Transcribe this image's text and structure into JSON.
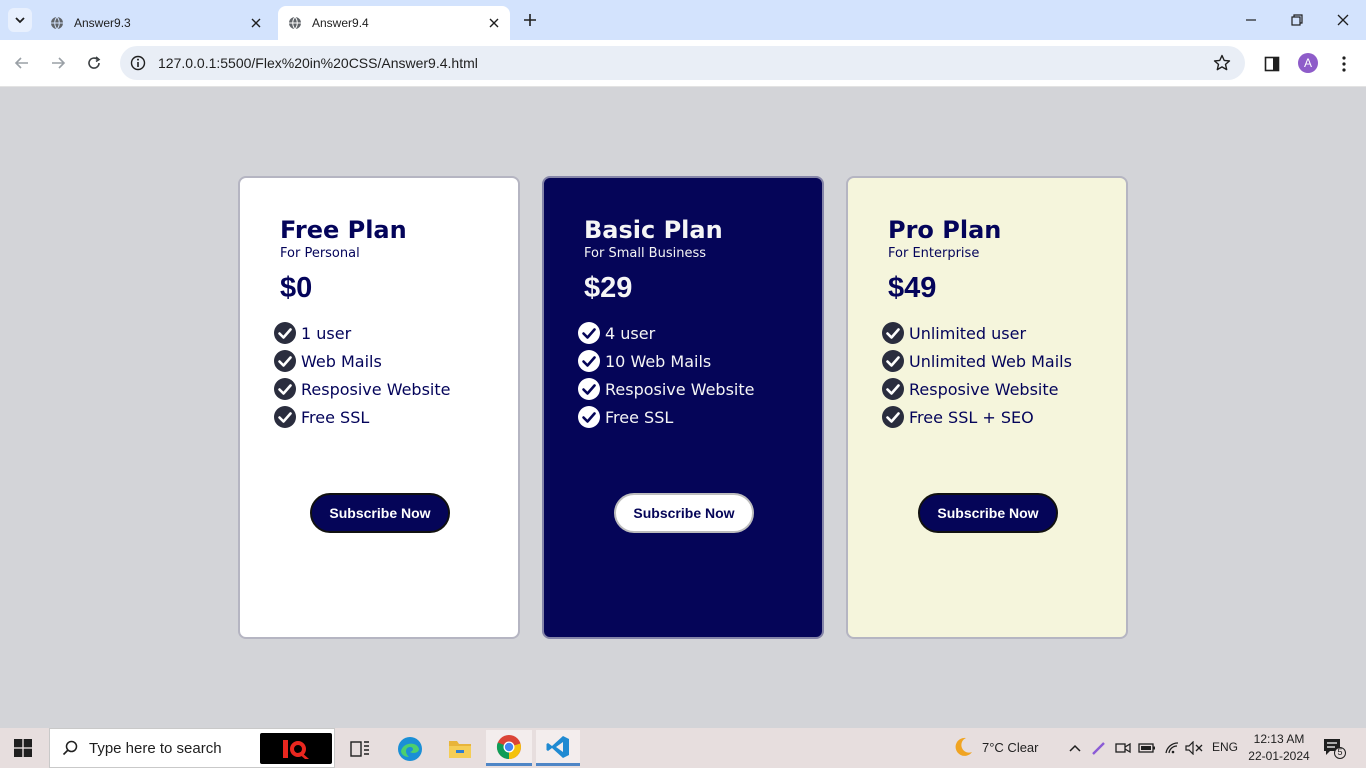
{
  "browser": {
    "tabs": [
      {
        "title": "Answer9.3",
        "active": false
      },
      {
        "title": "Answer9.4",
        "active": true
      }
    ],
    "url": "127.0.0.1:5500/Flex%20in%20CSS/Answer9.4.html",
    "profile_initial": "A"
  },
  "plans": [
    {
      "name": "Free Plan",
      "subtitle": "For Personal",
      "price": "$0",
      "features": [
        "1 user",
        "Web Mails",
        "Resposive Website",
        "Free SSL"
      ],
      "button": "Subscribe Now"
    },
    {
      "name": "Basic Plan",
      "subtitle": "For Small Business",
      "price": "$29",
      "features": [
        "4 user",
        "10 Web Mails",
        "Resposive Website",
        "Free SSL"
      ],
      "button": "Subscribe Now"
    },
    {
      "name": "Pro Plan",
      "subtitle": "For Enterprise",
      "price": "$49",
      "features": [
        "Unlimited user",
        "Unlimited Web Mails",
        "Resposive Website",
        "Free SSL + SEO"
      ],
      "button": "Subscribe Now"
    }
  ],
  "colors": {
    "page_bg": "#d3d4d8",
    "navy": "#050558",
    "cream": "#f5f5dc",
    "white": "#ffffff"
  },
  "taskbar": {
    "search_placeholder": "Type here to search",
    "weather": "7°C  Clear",
    "language": "ENG",
    "time": "12:13 AM",
    "date": "22-01-2024",
    "notification_count": "5"
  }
}
